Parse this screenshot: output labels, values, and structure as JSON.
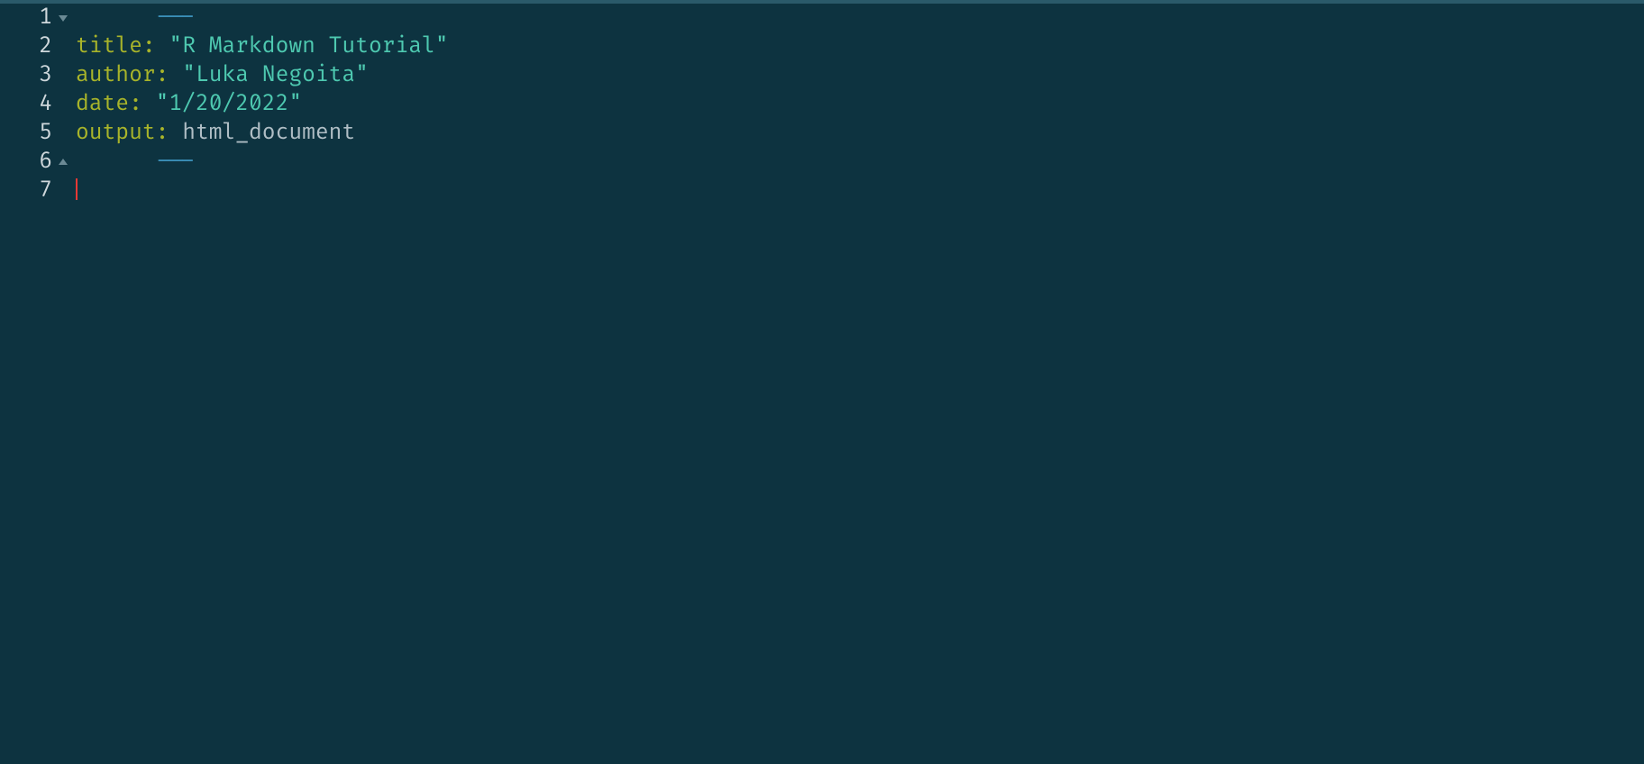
{
  "lines": {
    "l1": {
      "num": "1",
      "fold": "down",
      "dashes": "---"
    },
    "l2": {
      "num": "2",
      "key": "title",
      "colon": ":",
      "space": " ",
      "value": "\"R Markdown Tutorial\""
    },
    "l3": {
      "num": "3",
      "key": "author",
      "colon": ":",
      "space": " ",
      "value": "\"Luka Negoita\""
    },
    "l4": {
      "num": "4",
      "key": "date",
      "colon": ":",
      "space": " ",
      "value": "\"1/20/2022\""
    },
    "l5": {
      "num": "5",
      "key": "output",
      "colon": ":",
      "space": " ",
      "value": "html_document"
    },
    "l6": {
      "num": "6",
      "fold": "up",
      "dashes": "---"
    },
    "l7": {
      "num": "7"
    }
  }
}
